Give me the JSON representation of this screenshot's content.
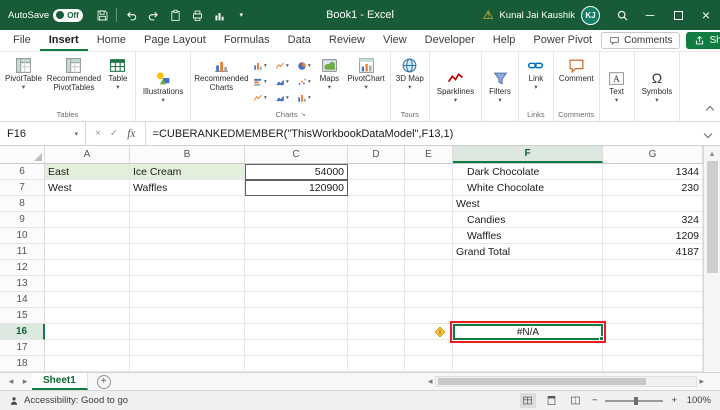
{
  "title_bar": {
    "autosave_label": "AutoSave",
    "autosave_state": "Off",
    "window_title": "Book1 - Excel",
    "user_name": "Kunal Jai Kaushik",
    "user_initials": "KJ"
  },
  "tabs": {
    "items": [
      "File",
      "Insert",
      "Home",
      "Page Layout",
      "Formulas",
      "Data",
      "Review",
      "View",
      "Developer",
      "Help",
      "Power Pivot"
    ],
    "active": "Insert",
    "comments_label": "Comments",
    "share_label": "Share"
  },
  "ribbon": {
    "tables": {
      "label": "Tables",
      "pivottable": "PivotTable",
      "recommended_pivottables": "Recommended PivotTables",
      "table": "Table"
    },
    "illustrations": {
      "button": "Illustrations"
    },
    "charts": {
      "label": "Charts",
      "recommended_charts": "Recommended Charts",
      "maps": "Maps",
      "pivotchart": "PivotChart"
    },
    "tours": {
      "label": "Tours",
      "map_3d": "3D Map"
    },
    "sparklines": {
      "button": "Sparklines"
    },
    "filters": {
      "button": "Filters"
    },
    "links": {
      "label": "Links",
      "link": "Link"
    },
    "comments": {
      "label": "Comments",
      "comment": "Comment"
    },
    "text": {
      "button": "Text"
    },
    "symbols": {
      "button": "Symbols"
    }
  },
  "formula_bar": {
    "name_box": "F16",
    "formula": "=CUBERANKEDMEMBER(\"ThisWorkbookDataModel\",F13,1)"
  },
  "grid": {
    "columns": [
      "A",
      "B",
      "C",
      "D",
      "E",
      "F",
      "G"
    ],
    "selected_column": "F",
    "selected_row": 16,
    "selected_cell": "F16",
    "error_value": "#N/A",
    "warning_cell": "E16",
    "rows": [
      {
        "n": "6",
        "cells": {
          "A": "East",
          "B": "Ice Cream",
          "C": "54000",
          "F": "Dark Chocolate",
          "G": "1344"
        }
      },
      {
        "n": "7",
        "cells": {
          "A": "West",
          "B": "Waffles",
          "C": "120900",
          "F": "White Chocolate",
          "G": "230"
        }
      },
      {
        "n": "8",
        "cells": {
          "F": "West"
        }
      },
      {
        "n": "9",
        "cells": {
          "F": "Candies",
          "G": "324"
        }
      },
      {
        "n": "10",
        "cells": {
          "F": "Waffles",
          "G": "1209"
        }
      },
      {
        "n": "11",
        "cells": {
          "F": "Grand Total",
          "G": "4187"
        }
      },
      {
        "n": "12",
        "cells": {}
      },
      {
        "n": "13",
        "cells": {}
      },
      {
        "n": "14",
        "cells": {}
      },
      {
        "n": "15",
        "cells": {}
      },
      {
        "n": "16",
        "cells": {
          "F": "#N/A"
        }
      },
      {
        "n": "17",
        "cells": {}
      },
      {
        "n": "18",
        "cells": {}
      }
    ]
  },
  "sheet_bar": {
    "sheet_name": "Sheet1",
    "add_sheet": "+"
  },
  "status_bar": {
    "accessibility": "Accessibility: Good to go",
    "zoom": "100%"
  },
  "icons": {
    "caret_down": "▾",
    "warning": "⚠",
    "minimize": "─",
    "close": "×",
    "cancel": "×",
    "check": "✓",
    "fx": "fx",
    "dialog_launcher": "↘",
    "nav_left": "◂",
    "nav_right": "▸",
    "scroll_up": "▴",
    "zoom_out": "−",
    "zoom_in": "+"
  },
  "colors": {
    "titlebar_green": "#185C37",
    "accent_green": "#107C41",
    "cell_fill_green": "#E2EFDA",
    "annotation_red": "#ED1C24",
    "warning_yellow": "#FFC83D",
    "avatar_teal": "#128069"
  }
}
